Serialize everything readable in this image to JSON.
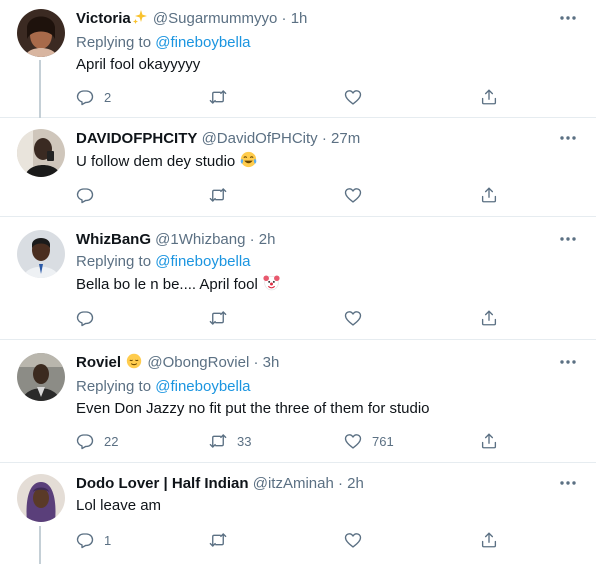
{
  "tweets": [
    {
      "name": "Victoria",
      "name_emoji": "sparkles",
      "handle": "@Sugarmummyyo",
      "time": "1h",
      "replying_label": "Replying to",
      "replying_to": "@fineboybella",
      "text": "April fool okayyyyy",
      "reply_count": "2",
      "retweet_count": "",
      "like_count": ""
    },
    {
      "name": "DAVIDOFPHCITY",
      "handle": "@DavidOfPHCity",
      "time": "27m",
      "text": "U follow dem dey studio",
      "text_emoji": "face-with-tears-of-joy",
      "reply_count": "",
      "retweet_count": "",
      "like_count": ""
    },
    {
      "name": "WhizBanG",
      "handle": "@1Whizbang",
      "time": "2h",
      "replying_label": "Replying to",
      "replying_to": "@fineboybella",
      "text": "Bella bo le n be.... April fool",
      "text_emoji": "clown-face",
      "reply_count": "",
      "retweet_count": "",
      "like_count": ""
    },
    {
      "name": "Roviel",
      "name_emoji": "relieved-face",
      "handle": "@ObongRoviel",
      "time": "3h",
      "replying_label": "Replying to",
      "replying_to": "@fineboybella",
      "text": "Even Don Jazzy no fit put the three of them for studio",
      "reply_count": "22",
      "retweet_count": "33",
      "like_count": "761"
    },
    {
      "name": "Dodo Lover | Half Indian",
      "handle": "@itzAminah",
      "time": "2h",
      "text": "Lol leave am",
      "reply_count": "1",
      "retweet_count": "",
      "like_count": ""
    }
  ],
  "separator": "·",
  "colors": {
    "text": "#0f1419",
    "secondary": "#5b7083",
    "mention": "#1b95e0",
    "border": "#e6ecf0",
    "thread_line": "#c4cfd6"
  },
  "icons": {
    "reply": "reply-icon",
    "retweet": "retweet-icon",
    "like": "like-icon",
    "share": "share-icon",
    "more": "more-icon"
  }
}
